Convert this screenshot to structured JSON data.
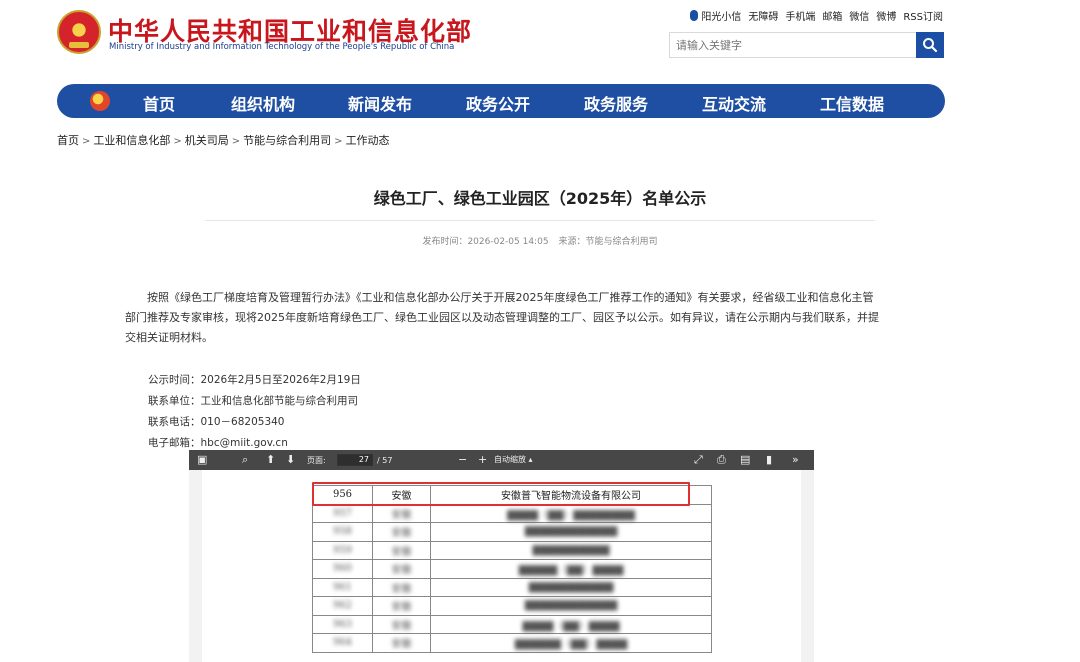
{
  "header": {
    "logo_cn": "中华人民共和国工业和信息化部",
    "logo_en": "Ministry of Industry and Information Technology of the People's Republic of China"
  },
  "toplinks": [
    "阳光小信",
    "无障碍",
    "手机端",
    "邮箱",
    "微信",
    "微博",
    "RSS订阅"
  ],
  "search": {
    "placeholder": "请输入关键字"
  },
  "nav": [
    "首页",
    "组织机构",
    "新闻发布",
    "政务公开",
    "政务服务",
    "互动交流",
    "工信数据"
  ],
  "breadcrumb": [
    "首页",
    "工业和信息化部",
    "机关司局",
    "节能与综合利用司",
    "工作动态"
  ],
  "article": {
    "title": "绿色工厂、绿色工业园区（2025年）名单公示",
    "publish_time": "发布时间：2026-02-05 14:05",
    "source": "来源：节能与综合利用司",
    "paragraph": "按照《绿色工厂梯度培育及管理暂行办法》《工业和信息化部办公厅关于开展2025年度绿色工厂推荐工作的通知》有关要求，经省级工业和信息化主管部门推荐及专家审核，现将2025年度新培育绿色工厂、绿色工业园区以及动态管理调整的工厂、园区予以公示。如有异议，请在公示期内与我们联系，并提交相关证明材料。",
    "contact": [
      "公示时间：2026年2月5日至2026年2月19日",
      "联系单位：工业和信息化部节能与综合利用司",
      "联系电话：010－68205340",
      "电子邮箱：hbc@miit.gov.cn"
    ]
  },
  "pdf_viewer": {
    "page_label": "页面:",
    "page_current": "27",
    "page_total": "/ 57",
    "zoom": "自动缩放"
  },
  "table_rows": [
    {
      "no": "956",
      "province": "安徽",
      "company": "安徽普飞智能物流设备有限公司"
    },
    {
      "no": "957",
      "province": "安徽",
      "company": "▇▇▇▇（▇▇）▇▇▇▇▇▇▇▇"
    },
    {
      "no": "958",
      "province": "安徽",
      "company": "▇▇▇▇▇▇▇▇▇▇▇▇"
    },
    {
      "no": "959",
      "province": "安徽",
      "company": "▇▇▇▇▇▇▇▇▇▇"
    },
    {
      "no": "960",
      "province": "安徽",
      "company": "▇▇▇▇▇（▇▇）▇▇▇▇"
    },
    {
      "no": "961",
      "province": "安徽",
      "company": "▇▇▇▇▇▇▇▇▇▇▇"
    },
    {
      "no": "962",
      "province": "安徽",
      "company": "▇▇▇▇▇▇▇▇▇▇▇▇"
    },
    {
      "no": "963",
      "province": "安徽",
      "company": "▇▇▇▇（▇▇）▇▇▇▇"
    },
    {
      "no": "964",
      "province": "安徽",
      "company": "▇▇▇▇▇▇（▇▇）▇▇▇▇"
    }
  ]
}
